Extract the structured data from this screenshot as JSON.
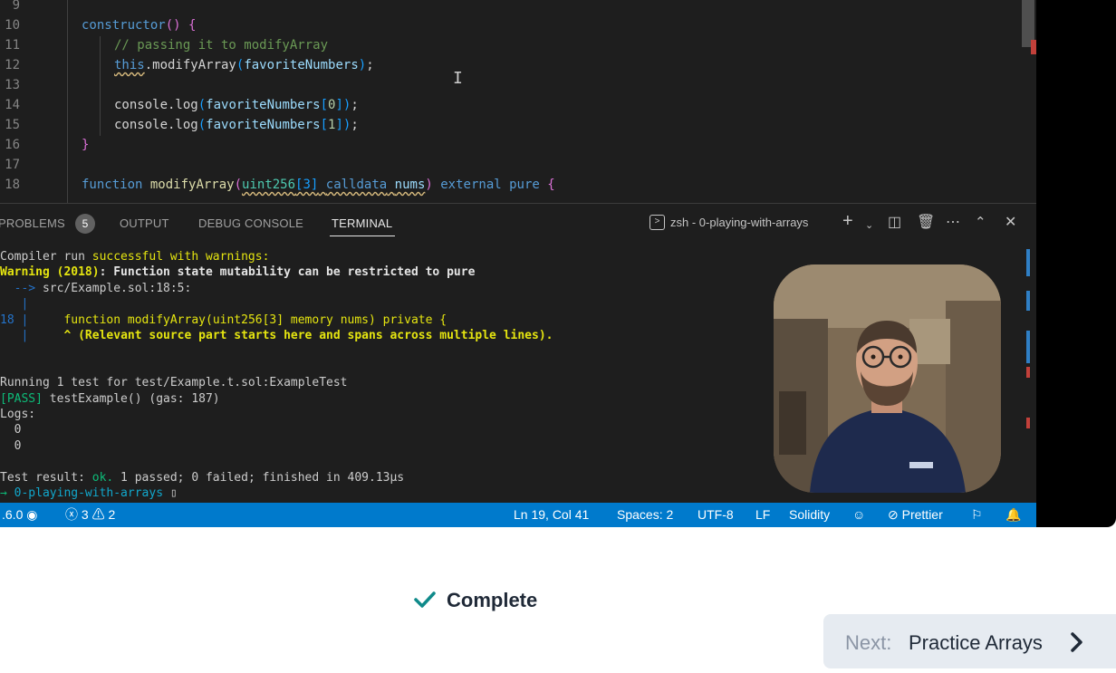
{
  "editor": {
    "lines": [
      {
        "n": "9"
      },
      {
        "n": "10",
        "parts": [
          [
            "kw",
            "constructor"
          ],
          [
            "br1",
            "()"
          ],
          [
            "",
            " "
          ],
          [
            "br1",
            "{"
          ]
        ]
      },
      {
        "n": "11",
        "parts": [
          [
            "cm",
            "// passing it to modifyArray"
          ]
        ]
      },
      {
        "n": "12",
        "parts": [
          [
            "kw squig",
            "this"
          ],
          [
            "",
            ".modifyArray"
          ],
          [
            "br2",
            "("
          ],
          [
            "var",
            "favoriteNumbers"
          ],
          [
            "br2",
            ")"
          ],
          [
            "",
            ";"
          ]
        ]
      },
      {
        "n": "13"
      },
      {
        "n": "14",
        "parts": [
          [
            "",
            "console.log"
          ],
          [
            "br2",
            "("
          ],
          [
            "var",
            "favoriteNumbers"
          ],
          [
            "br2",
            "["
          ],
          [
            "num",
            "0"
          ],
          [
            "br2",
            "]"
          ],
          [
            "br2",
            ")"
          ],
          [
            "",
            ";"
          ]
        ]
      },
      {
        "n": "15",
        "parts": [
          [
            "",
            "console.log"
          ],
          [
            "br2",
            "("
          ],
          [
            "var",
            "favoriteNumbers"
          ],
          [
            "br2",
            "["
          ],
          [
            "num",
            "1"
          ],
          [
            "br2",
            "]"
          ],
          [
            "br2",
            ")"
          ],
          [
            "",
            ";"
          ]
        ]
      },
      {
        "n": "16",
        "parts": [
          [
            "br1",
            "}"
          ]
        ]
      },
      {
        "n": "17"
      },
      {
        "n": "18",
        "parts": [
          [
            "kw",
            "function"
          ],
          [
            "",
            " "
          ],
          [
            "fn",
            "modifyArray"
          ],
          [
            "br1",
            "("
          ],
          [
            "ty squig",
            "uint256"
          ],
          [
            "br2 squig",
            "[3]"
          ],
          [
            "squig",
            " "
          ],
          [
            "kw squig",
            "calldata"
          ],
          [
            "squig",
            " "
          ],
          [
            "var squig",
            "nums"
          ],
          [
            "br1",
            ")"
          ],
          [
            "",
            " "
          ],
          [
            "kw",
            "external"
          ],
          [
            "",
            " "
          ],
          [
            "kw",
            "pure"
          ],
          [
            "",
            " "
          ],
          [
            "br1",
            "{"
          ]
        ]
      }
    ]
  },
  "panel": {
    "tabs": [
      "PROBLEMS",
      "OUTPUT",
      "DEBUG CONSOLE",
      "TERMINAL"
    ],
    "problems_count": "5",
    "terminal_name": "zsh - 0-playing-with-arrays"
  },
  "terminal": {
    "lines": [
      [
        [
          "",
          "Compiler run "
        ],
        [
          "y",
          "successful with warnings:"
        ]
      ],
      [
        [
          "yb",
          "Warning (2018)"
        ],
        [
          "wb",
          ": Function state mutability can be restricted to pure"
        ]
      ],
      [
        [
          "b",
          "  --> "
        ],
        [
          "",
          "src/Example.sol:18:5:"
        ]
      ],
      [
        [
          "b",
          "   |"
        ]
      ],
      [
        [
          "b",
          "18 |"
        ],
        [
          "",
          "     "
        ],
        [
          "y",
          "function modifyArray(uint256[3] memory nums) private {"
        ]
      ],
      [
        [
          "b",
          "   |"
        ],
        [
          "",
          "     "
        ],
        [
          "yb",
          "^ (Relevant source part starts here and spans across multiple lines)."
        ]
      ],
      [],
      [],
      [
        [
          "",
          "Running 1 test for test/Example.t.sol:ExampleTest"
        ]
      ],
      [
        [
          "g",
          "[PASS]"
        ],
        [
          "",
          " testExample() (gas: 187)"
        ]
      ],
      [
        [
          "",
          "Logs:"
        ]
      ],
      [
        [
          "",
          "  0"
        ]
      ],
      [
        [
          "",
          "  0"
        ]
      ],
      [],
      [
        [
          "",
          "Test result: "
        ],
        [
          "g",
          "ok."
        ],
        [
          "",
          " 1 passed; 0 failed; finished in 409.13µs"
        ]
      ],
      [
        [
          "g",
          "→ "
        ],
        [
          "c",
          "0-playing-with-arrays"
        ],
        [
          "",
          " ▯"
        ]
      ]
    ]
  },
  "status_bar": {
    "version": ".6.0",
    "errors": "3",
    "warnings": "2",
    "position": "Ln 19, Col 41",
    "spaces": "Spaces: 2",
    "encoding": "UTF-8",
    "eol": "LF",
    "language": "Solidity",
    "prettier": "Prettier"
  },
  "lesson": {
    "complete_label": "Complete",
    "next_prefix": "Next:",
    "next_title": "Practice Arrays"
  },
  "colors": {
    "status_bar": "#007acc",
    "check": "#0f8a8a"
  }
}
